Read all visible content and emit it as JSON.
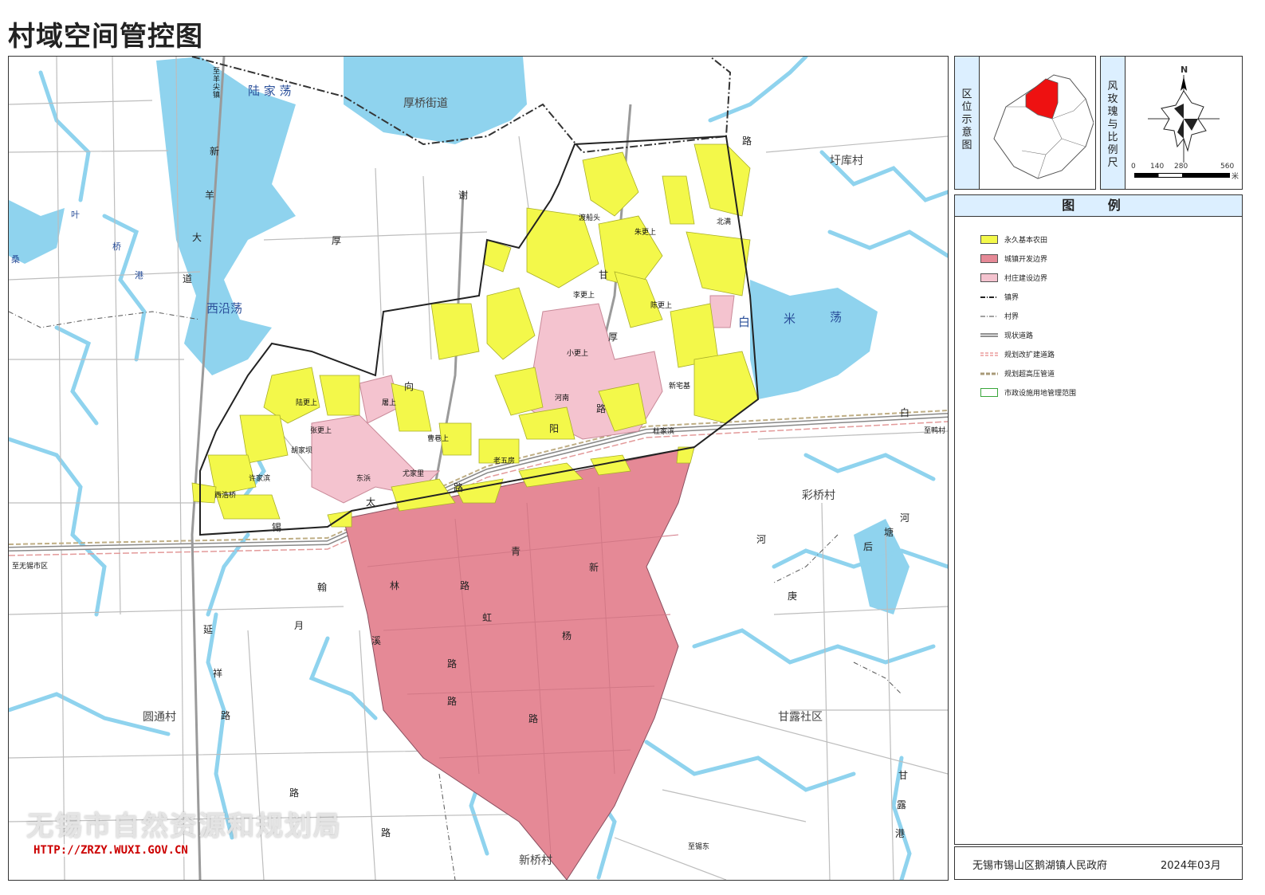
{
  "title": "村域空间管控图",
  "watermark": {
    "org": "无锡市自然资源和规划局",
    "url": "HTTP://ZRZY.WUXI.GOV.CN"
  },
  "map": {
    "place_labels": [
      "厚桥街道",
      "圩库村",
      "彩桥村",
      "甘露社区",
      "圆通村",
      "新桥村"
    ],
    "water_labels": [
      "陆 家 荡",
      "西沿荡",
      "白",
      "米",
      "荡",
      "叶",
      "桑",
      "桥",
      "港"
    ],
    "village_labels": [
      "渡船头",
      "北满",
      "朱更上",
      "李更上",
      "陈更上",
      "小更上",
      "河南",
      "新宅基",
      "杜家滨",
      "曹巷上",
      "老五房",
      "陆更上",
      "屠上",
      "张更上",
      "胡家坝",
      "东浜",
      "尤家里",
      "许家滨",
      "西浩桥"
    ],
    "road_labels": [
      "新",
      "羊",
      "大",
      "道",
      "谢",
      "厚",
      "甘",
      "厚",
      "路",
      "路",
      "太",
      "锡",
      "路",
      "阳",
      "青",
      "林",
      "路",
      "新",
      "虹",
      "杨",
      "路",
      "路",
      "路",
      "翰",
      "月",
      "溪",
      "延",
      "祥",
      "路",
      "路",
      "路",
      "甘",
      "露",
      "港",
      "河",
      "庚",
      "后",
      "塘",
      "河",
      "白",
      "向"
    ],
    "small_labels": [
      "至羊尖镇",
      "至无锡市区",
      "至鸭村",
      "至锡东"
    ]
  },
  "location_panel": {
    "heading": "区位示意图"
  },
  "compass_panel": {
    "heading": "风玫瑰与比例尺",
    "north": "N",
    "scale_ticks": [
      "0",
      "140",
      "280",
      "560"
    ],
    "unit": "米"
  },
  "legend": {
    "heading": "图 例",
    "items": [
      {
        "label": "永久基本农田",
        "color": "#f3f84a"
      },
      {
        "label": "城镇开发边界",
        "color": "#e58996"
      },
      {
        "label": "村庄建设边界",
        "color": "#f4c3cf"
      },
      {
        "label": "镇界"
      },
      {
        "label": "村界"
      },
      {
        "label": "现状道路"
      },
      {
        "label": "规划改扩建道路"
      },
      {
        "label": "规划超高压管道"
      },
      {
        "label": "市政设施用地管理范围"
      }
    ]
  },
  "footer": {
    "org": "无锡市锡山区鹅湖镇人民政府",
    "date": "2024年03月"
  }
}
